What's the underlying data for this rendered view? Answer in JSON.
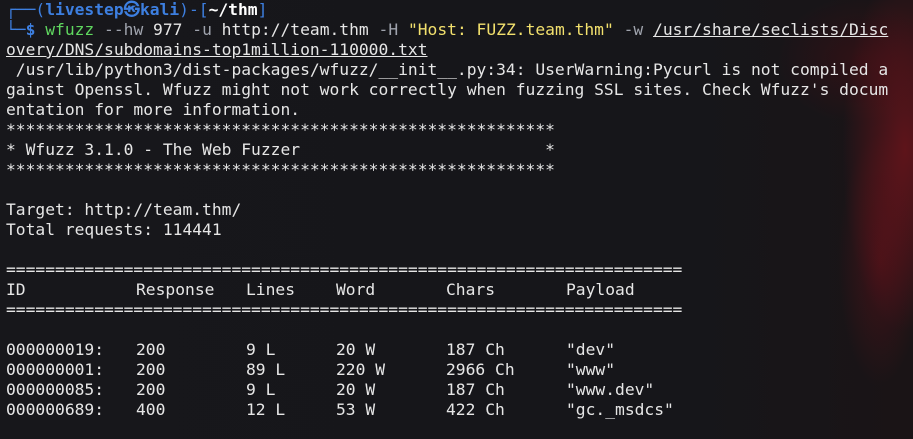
{
  "prompt": {
    "corner_top": "┌──(",
    "user": "livestep",
    "skull": "㉿",
    "host": "kali",
    "mid": ")-[",
    "dir": "~/thm",
    "close": "]",
    "corner_bottom": "└─",
    "dollar": "$ "
  },
  "command": {
    "program": "wfuzz",
    "flag_hw": " --hw",
    "hw_value": " 977 ",
    "flag_u": "-u",
    "url": " http://team.thm ",
    "flag_h": "-H ",
    "header": "\"Host: FUZZ.team.thm\"",
    "flag_w": " -w ",
    "wordlist_1": "/usr/share/seclists/Disc",
    "wordlist_2": "overy/DNS/subdomains-top1million-110000.txt"
  },
  "warning": {
    "line1": " /usr/lib/python3/dist-packages/wfuzz/__init__.py:34: UserWarning:Pycurl is not compiled a",
    "line2": "gainst Openssl. Wfuzz might not work correctly when fuzzing SSL sites. Check Wfuzz's docum",
    "line3": "entation for more information."
  },
  "banner": {
    "border": "********************************************************",
    "title": "* Wfuzz 3.1.0 - The Web Fuzzer                         *"
  },
  "target_info": {
    "target": "Target: http://team.thm/",
    "total": "Total requests: 114441"
  },
  "results": {
    "separator": "=====================================================================",
    "headers": [
      "ID",
      "Response",
      "Lines",
      "Word",
      "Chars",
      "Payload"
    ],
    "rows": [
      [
        "000000019:",
        "200",
        "9 L",
        "20 W",
        "187 Ch",
        "\"dev\""
      ],
      [
        "000000001:",
        "200",
        "89 L",
        "220 W",
        "2966 Ch",
        "\"www\""
      ],
      [
        "000000085:",
        "200",
        "9 L",
        "20 W",
        "187 Ch",
        "\"www.dev\""
      ],
      [
        "000000689:",
        "400",
        "12 L",
        "53 W",
        "422 Ch",
        "\"gc._msdcs\""
      ]
    ]
  }
}
